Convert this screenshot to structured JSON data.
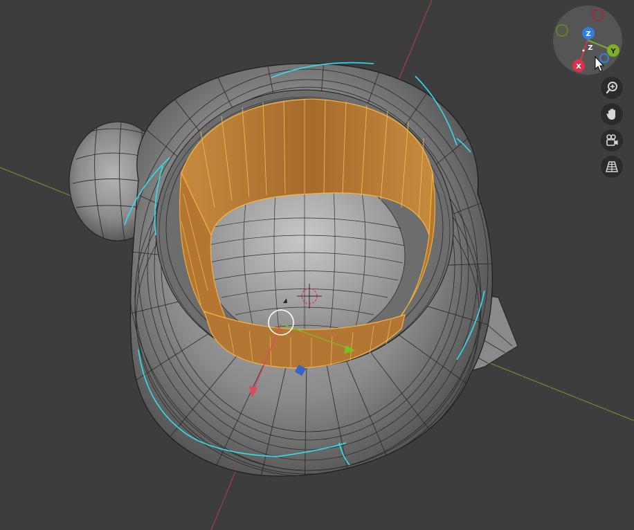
{
  "app": "3D viewport",
  "gizmo": {
    "axes": [
      {
        "id": "x",
        "label": "X",
        "color": "#e0314b"
      },
      {
        "id": "y",
        "label": "Y",
        "color": "#7eb224"
      },
      {
        "id": "z",
        "label": "Z",
        "color": "#2f7ee0"
      },
      {
        "id": "z-neg",
        "label": "Z",
        "color": "#ffffff"
      }
    ],
    "negative_axes": [
      {
        "id": "-x",
        "color": "#9b2b3e"
      },
      {
        "id": "-y",
        "color": "#5a8a1d"
      },
      {
        "id": "-z",
        "color": "#2f7ee0"
      }
    ]
  },
  "nav_buttons": [
    {
      "id": "zoom",
      "icon": "zoom-in-icon"
    },
    {
      "id": "pan",
      "icon": "hand-icon"
    },
    {
      "id": "camera",
      "icon": "camera-icon"
    },
    {
      "id": "perspective",
      "icon": "grid-perspective-icon"
    }
  ],
  "colors": {
    "background": "#3d3d3d",
    "selection": "#f3a03a",
    "edge_seam": "#2fe1f0",
    "mesh": "#9a9a9a",
    "x_axis_line": "#b04a5a",
    "y_axis_line": "#7a9a2a"
  }
}
